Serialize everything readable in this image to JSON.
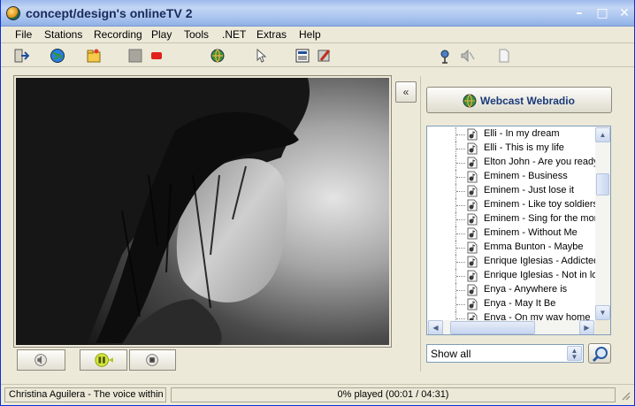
{
  "window": {
    "title": "concept/design's onlineTV 2",
    "controls": {
      "minimize": "–",
      "maximize": "□",
      "close": "✕"
    }
  },
  "menu": {
    "items": [
      {
        "label": "File"
      },
      {
        "label": "Stations"
      },
      {
        "label": "Recording"
      },
      {
        "label": "Play"
      },
      {
        "label": "Tools"
      },
      {
        "label": ".NET"
      },
      {
        "label": "Extras"
      },
      {
        "label": "Help"
      }
    ]
  },
  "toolbar": {
    "icons": [
      "exit-icon",
      "globe-icon",
      "folder-star-icon",
      "stop-square-icon",
      "record-icon",
      "web-globe-icon",
      "pointer-icon",
      "screen-capture-icon",
      "settings-icon",
      "radio-antenna-icon",
      "mute-icon",
      "document-icon"
    ]
  },
  "player": {
    "controls": [
      "volume-icon",
      "pause-icon",
      "stop-icon"
    ],
    "collapse_label": "«"
  },
  "side_panel": {
    "webcast_label": "Webcast Webradio",
    "list": [
      "Elli - In my dream",
      "Elli - This is my life",
      "Elton John - Are you ready",
      "Eminem - Business",
      "Eminem - Just lose it",
      "Eminem - Like toy soldiers",
      "Eminem - Sing for the mom",
      "Eminem - Without Me",
      "Emma Bunton - Maybe",
      "Enrique Iglesias - Addicted",
      "Enrique Iglesias - Not in lov",
      "Enya - Anywhere is",
      "Enya - May It Be",
      "Enya - On my way home"
    ],
    "filter_value": "Show all"
  },
  "status": {
    "now_playing": "Christina Aguilera - The voice within",
    "progress_text": "0% played  (00:01 / 04:31)",
    "progress_fraction": 0.0
  }
}
